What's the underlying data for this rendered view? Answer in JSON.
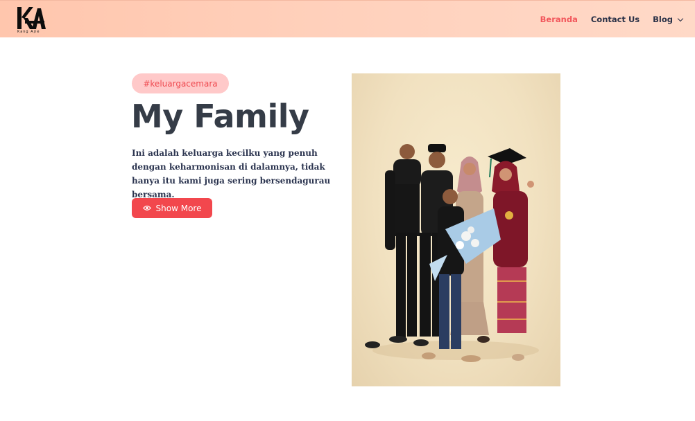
{
  "header": {
    "logo_text": "KA",
    "logo_subtext": "Kang Ajie",
    "nav": [
      {
        "label": "Beranda",
        "active": true
      },
      {
        "label": "Contact Us",
        "active": false
      },
      {
        "label": "Blog",
        "active": false,
        "icon": "chevron-down-icon"
      }
    ]
  },
  "hero": {
    "tag": "#keluargacemara",
    "title": "My Family",
    "description": "Ini adalah keluarga kecilku yang penuh dengan keharmonisan di dalamnya, tidak hanya itu kami juga sering bersendagurau bersama.",
    "button_label": "Show More",
    "button_icon": "eye-icon"
  },
  "colors": {
    "accent": "#f2474d",
    "active_nav": "#f2565b",
    "tag_bg": "#ffc9c9",
    "title": "#353c47",
    "header_bg": "#ffcbb3"
  }
}
